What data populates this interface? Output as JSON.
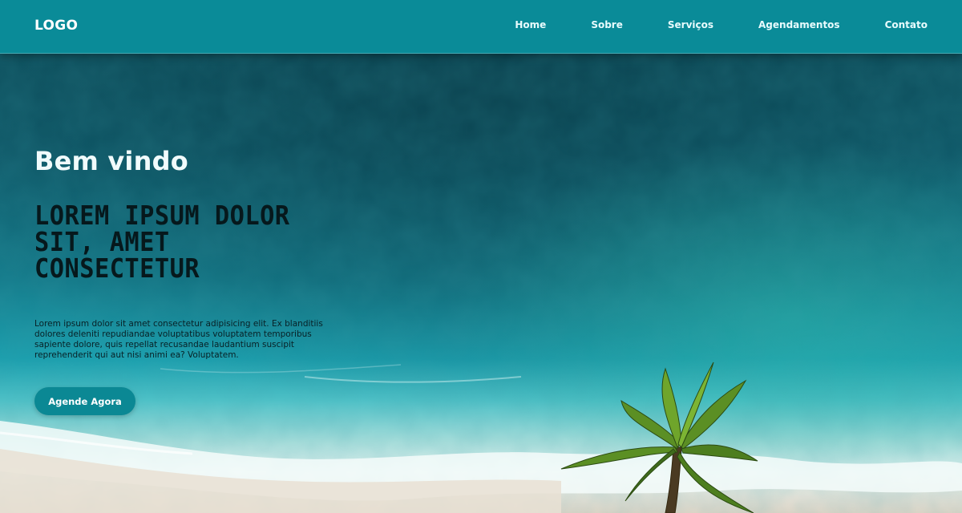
{
  "header": {
    "logo": "LOGO",
    "nav": [
      {
        "label": "Home"
      },
      {
        "label": "Sobre"
      },
      {
        "label": "Serviços"
      },
      {
        "label": "Agendamentos"
      },
      {
        "label": "Contato"
      }
    ]
  },
  "hero": {
    "welcome": "Bem vindo",
    "headline": "Lorem ipsum dolor sit, amet consectetur",
    "description": "Lorem ipsum dolor sit amet consectetur adipisicing elit. Ex blanditiis dolores deleniti repudiandae voluptatibus voluptatem temporibus sapiente dolore, quis repellat recusandae laudantium suscipit reprehenderit qui aut nisi animi ea? Voluptatem.",
    "cta_label": "Agende Agora"
  },
  "colors": {
    "navbar": "#0a8b98",
    "button": "#0b8894",
    "headline_text": "#06181c",
    "ocean_deep": "#0d4c5c",
    "ocean_shallow": "#1ca6b3",
    "sand": "#e8ddd0"
  },
  "icons": {
    "hero_image": "beach-ocean-aerial-photo",
    "palm": "palm-tree-icon"
  }
}
